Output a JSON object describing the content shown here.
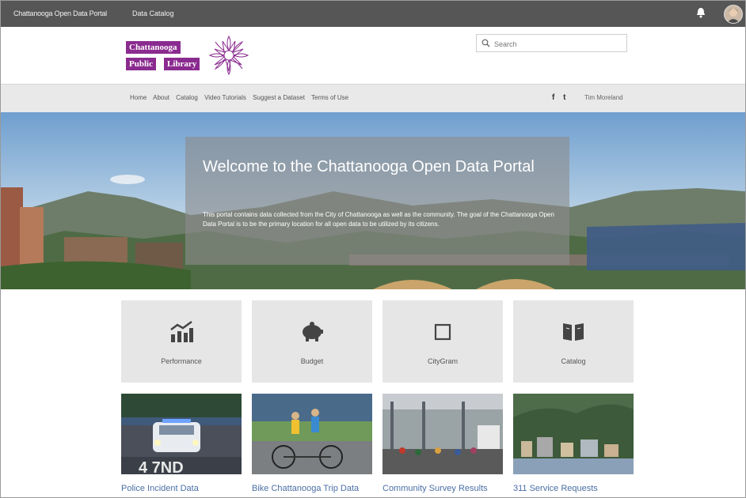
{
  "topbar": {
    "site_title": "Chattanooga Open Data Portal",
    "catalog_link": "Data Catalog"
  },
  "header": {
    "logo_words": [
      "Chattanooga",
      "Public",
      "Library"
    ],
    "search_placeholder": "Search"
  },
  "nav": {
    "links": [
      "Home",
      "About",
      "Catalog",
      "Video Tutorials",
      "Suggest a Dataset",
      "Terms of Use"
    ],
    "social": [
      "f",
      "t"
    ],
    "user_name": "Tim Moreland"
  },
  "hero": {
    "title": "Welcome to the Chattanooga Open Data Portal",
    "text": "This portal contains data collected from the City of Chattanooga as well as the community. The goal of the Chattanooga Open Data Portal is to be the primary location for all open data to be utilized by its citizens."
  },
  "tiles": [
    {
      "label": "Performance",
      "icon": "bar-chart-icon"
    },
    {
      "label": "Budget",
      "icon": "piggy-bank-icon"
    },
    {
      "label": "CityGram",
      "icon": "square-icon"
    },
    {
      "label": "Catalog",
      "icon": "book-icon"
    }
  ],
  "cards": [
    {
      "label": "Police Incident Data",
      "image": "police-car-photo"
    },
    {
      "label": "Bike Chattanooga Trip Data",
      "image": "tandem-bike-photo"
    },
    {
      "label": "Community Survey Results",
      "image": "market-crowd-photo"
    },
    {
      "label": "311 Service Requests",
      "image": "city-aerial-photo"
    }
  ],
  "colors": {
    "topbar": "#565656",
    "brand_purple": "#8a2b8f",
    "nav_bg": "#e9e9e9",
    "tile_bg": "#e6e6e6",
    "link_blue": "#4a6fa5"
  }
}
